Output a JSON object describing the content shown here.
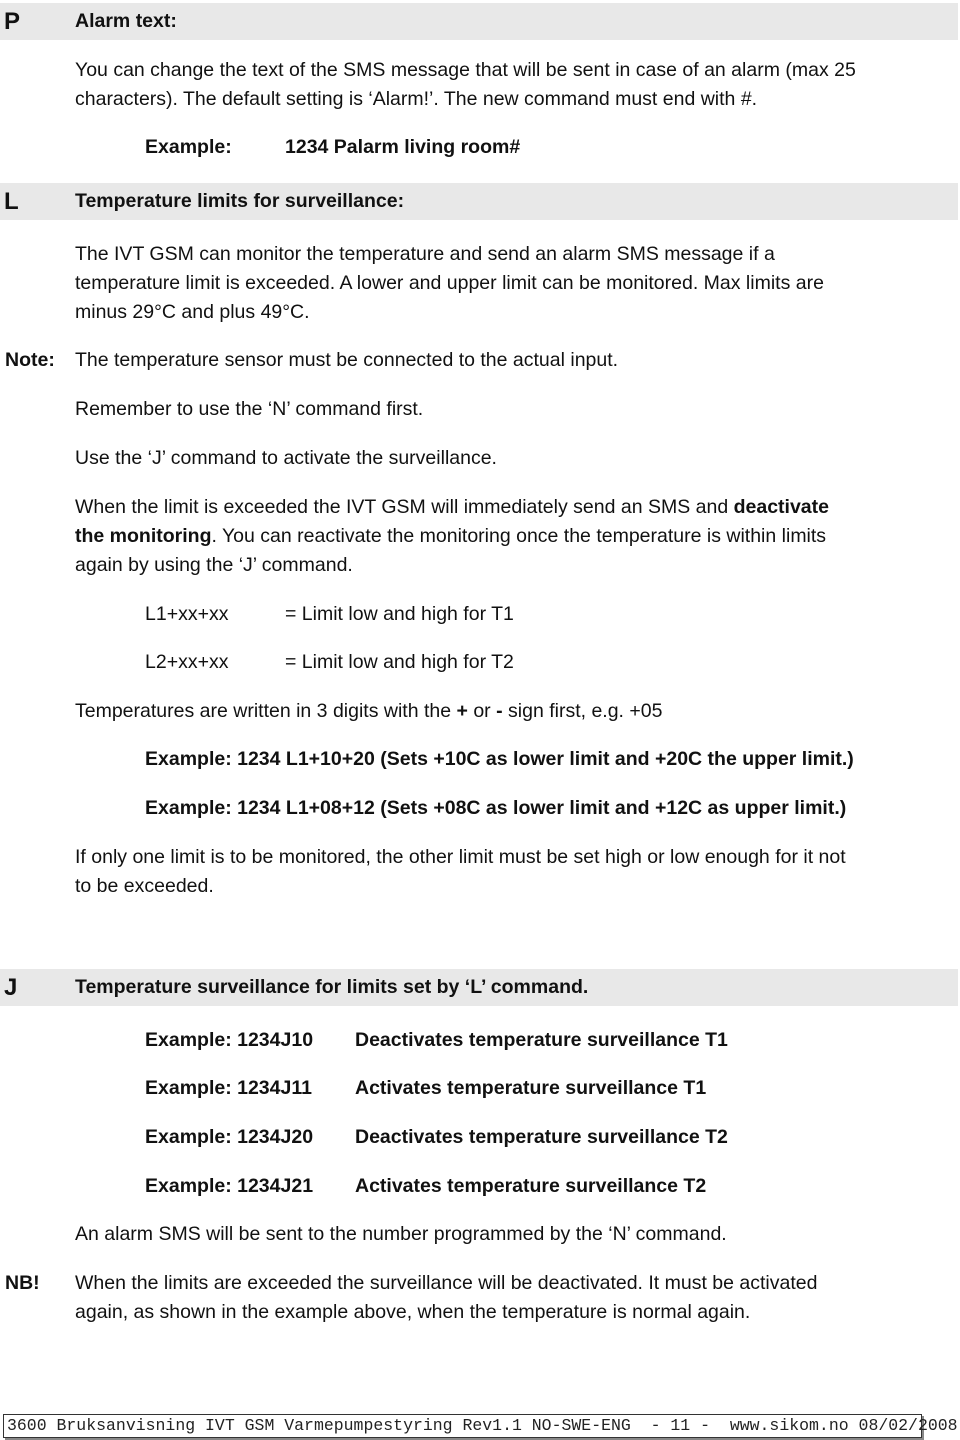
{
  "sections": {
    "p": {
      "letter": "P",
      "title": "Alarm text:",
      "para_line1": "You can change the text of the SMS message that will be sent in case of an alarm (max 25",
      "para_line2": "characters). The default setting is ‘Alarm!’.  The new command must end with #.",
      "example_label": "Example:",
      "example_value": "1234 Palarm living room#"
    },
    "l": {
      "letter": "L",
      "title": "Temperature limits for surveillance:",
      "intro_line1": "The IVT GSM can monitor the temperature and send an alarm SMS message if a",
      "intro_line2": "temperature limit is exceeded. A lower and upper limit can be monitored. Max limits are",
      "intro_line3": "minus 29°C and plus 49°C.",
      "note_label": "Note:",
      "note1": "The temperature sensor must be connected to the actual input.",
      "note2": "Remember to use the ‘N’ command first.",
      "note3": "Use the ‘J’ command to activate the surveillance.",
      "exceed_line1_a": "When the limit is exceeded the IVT GSM will immediately send an SMS and ",
      "exceed_line1_b": "deactivate",
      "exceed_line2_a": "the monitoring",
      "exceed_line2_b": ". You can reactivate the monitoring once the temperature is within limits",
      "exceed_line3": "again by using the ‘J’ command.",
      "commands": [
        {
          "cmd": "L1+xx+xx",
          "desc": "= Limit low and high for T1"
        },
        {
          "cmd": "L2+xx+xx",
          "desc": "= Limit low and high for T2"
        }
      ],
      "digits_a": "Temperatures are written in 3 digits with the ",
      "digits_plus": "+",
      "digits_b": " or ",
      "digits_minus": "-",
      "digits_c": " sign first, e.g. +05",
      "example1": "Example: 1234 L1+10+20 (Sets +10C as lower limit and +20C the upper limit.)",
      "example2": "Example: 1234 L1+08+12 (Sets +08C as lower limit and +12C as upper limit.)",
      "one_limit_line1": "If only one limit is to be monitored, the other limit must be set high or low enough for it not",
      "one_limit_line2": "to be exceeded."
    },
    "j": {
      "letter": "J",
      "title": "Temperature surveillance for limits set by  ‘L’ command.",
      "examples": [
        {
          "code": "Example: 1234J10",
          "desc": "Deactivates temperature surveillance T1"
        },
        {
          "code": "Example: 1234J11",
          "desc": "Activates temperature surveillance T1"
        },
        {
          "code": "Example: 1234J20",
          "desc": "Deactivates temperature surveillance T2"
        },
        {
          "code": "Example:  1234J21",
          "desc": "Activates temperature surveillance T2"
        }
      ],
      "alarm_note": "An alarm SMS will be sent to the number programmed by the ‘N’ command.",
      "nb_label": "NB!",
      "nb_line1": "When the limits are exceeded the surveillance will be deactivated. It must be activated",
      "nb_line2": "again, as shown in the example above, when the temperature is normal again."
    }
  },
  "footer": {
    "text": "3600 Bruksanvisning IVT GSM Varmepumpestyring Rev1.1 NO-SWE-ENG  - 11 -  www.sikom.no 08/02/2008"
  },
  "colors": {
    "band": "#e8e8e8",
    "text": "#111111"
  }
}
